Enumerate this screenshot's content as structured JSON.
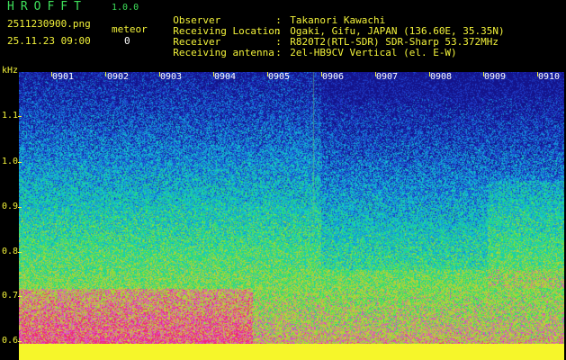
{
  "header": {
    "app_name": "HROFFT",
    "app_version": "1.0.0",
    "filename": "2511230900.png",
    "datetime": "25.11.23 09:00",
    "meteor_label": "meteor",
    "meteor_count": "0"
  },
  "info": [
    {
      "key": "Observer",
      "sep": ":",
      "value": "Takanori Kawachi"
    },
    {
      "key": "Receiving Location",
      "sep": ":",
      "value": "Ogaki, Gifu, JAPAN (136.60E, 35.35N)"
    },
    {
      "key": "Receiver",
      "sep": ":",
      "value": "R820T2(RTL-SDR) SDR-Sharp 53.372MHz"
    },
    {
      "key": "Receiving antenna",
      "sep": ":",
      "value": "2el-HB9CV Vertical (el. E-W)"
    }
  ],
  "axis": {
    "y_unit": "kHz",
    "y_ticks": [
      "1.1",
      "1.0",
      "0.9",
      "0.8",
      "0.7",
      "0.6"
    ],
    "x_ticks": [
      "0901",
      "0902",
      "0903",
      "0904",
      "0905",
      "0906",
      "0907",
      "0908",
      "0909",
      "0910"
    ]
  },
  "colors": {
    "text_green": "#3ee05a",
    "text_yellow": "#f2f23a",
    "baseline_yellow": "#f6f62a"
  }
}
